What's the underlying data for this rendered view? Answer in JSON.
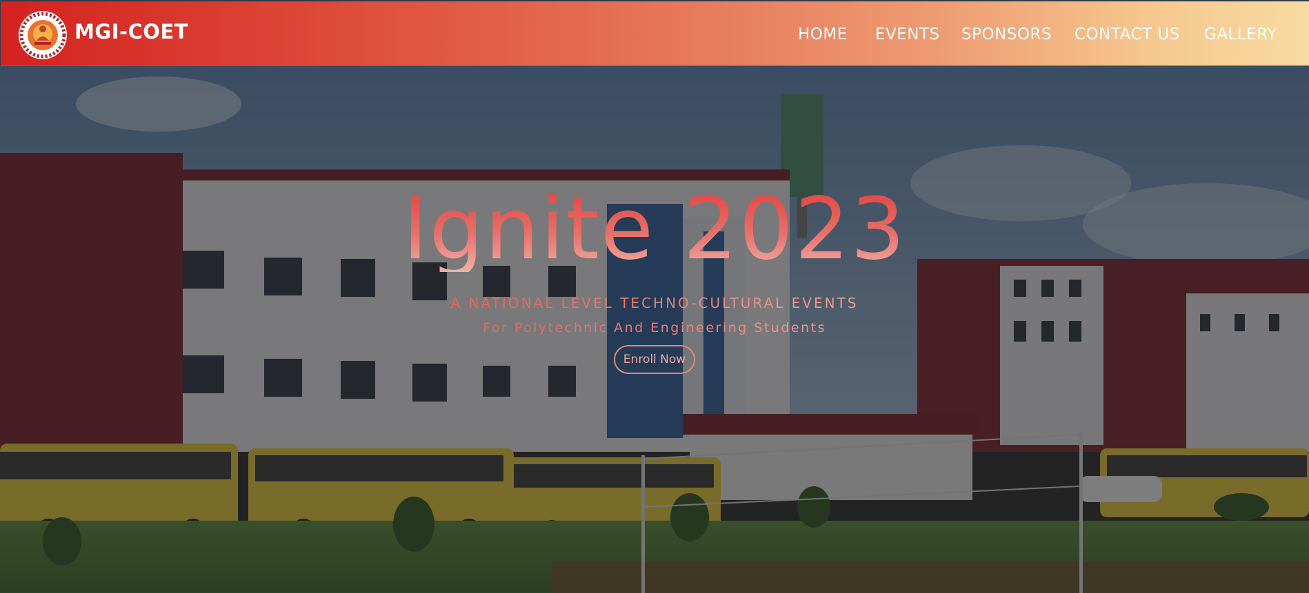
{
  "header": {
    "logo_icon": "college-emblem-icon",
    "brand": "MGI-COET",
    "nav": [
      {
        "label": "HOME"
      },
      {
        "label": "EVENTS"
      },
      {
        "label": "SPONSORS"
      },
      {
        "label": "CONTACT US"
      },
      {
        "label": "GALLERY"
      }
    ],
    "gradient_colors": [
      "#d42220",
      "#e57458",
      "#f7dba2"
    ]
  },
  "hero": {
    "background_image": "college-campus-photo",
    "title": "Ignite 2023",
    "tagline": "A NATIONAL LEVEL TECHNO-CULTURAL EVENTS",
    "subtagline": "For Polytechnic And Engineering Students",
    "cta_label": "Enroll Now",
    "accent_color": "#e2433f"
  }
}
